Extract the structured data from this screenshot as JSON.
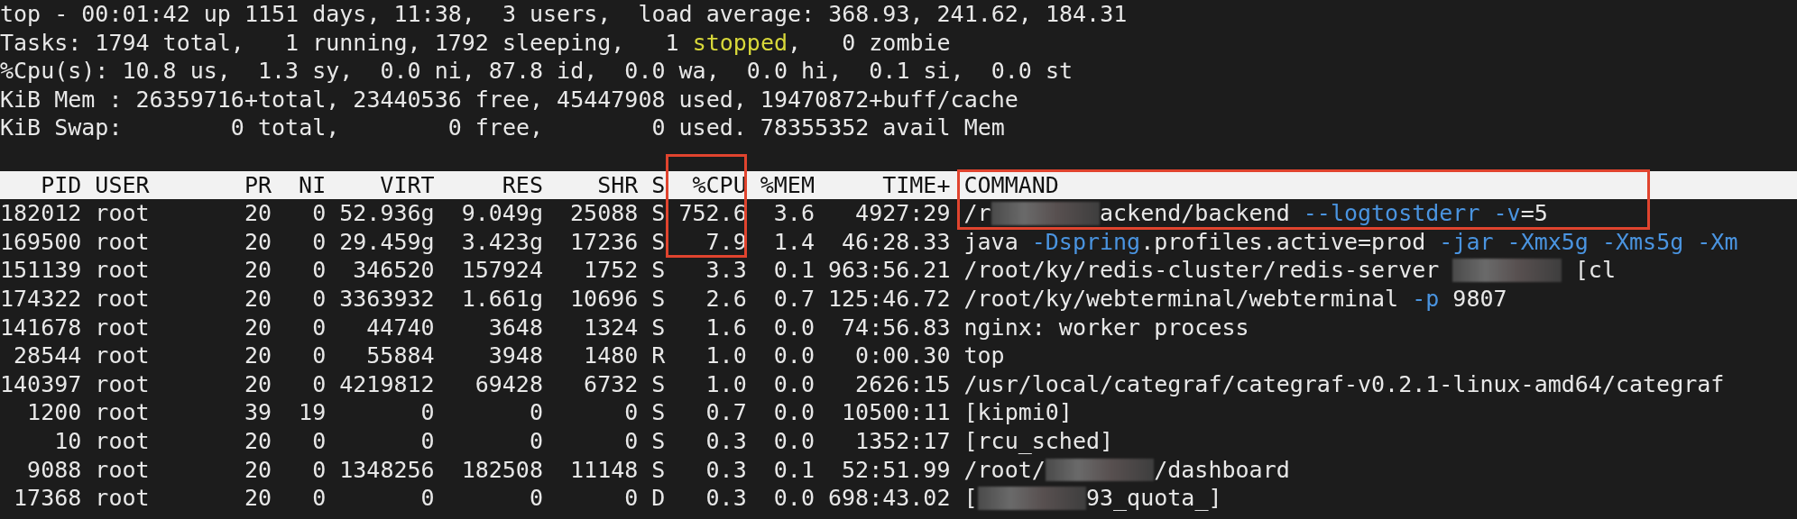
{
  "summary": [
    [
      {
        "kind": "plain",
        "text": "top - 00:01:42 up 1151 days, 11:38,  3 users,  load average: 368.93, 241.62, 184.31"
      }
    ],
    [
      {
        "kind": "plain",
        "text": "Tasks: 1794 total,   1 running, 1792 sleeping,   1 "
      },
      {
        "kind": "stopped",
        "text": "stopped"
      },
      {
        "kind": "plain",
        "text": ",   0 zombie"
      }
    ],
    [
      {
        "kind": "plain",
        "text": "%Cpu(s): 10.8 us,  1.3 sy,  0.0 ni, 87.8 id,  0.0 wa,  0.0 hi,  0.1 si,  0.0 st"
      }
    ],
    [
      {
        "kind": "plain",
        "text": "KiB Mem : 26359716+total, 23440536 free, 45447908 used, 19470872+buff/cache"
      }
    ],
    [
      {
        "kind": "plain",
        "text": "KiB Swap:        0 total,        0 free,        0 used. 78355352 avail Mem"
      }
    ]
  ],
  "columns": [
    "PID",
    "USER",
    "PR",
    "NI",
    "VIRT",
    "RES",
    "SHR",
    "S",
    "%CPU",
    "%MEM",
    "TIME+",
    "COMMAND"
  ],
  "rows": [
    {
      "cpu_boxed": true,
      "command_boxed": true,
      "cells": [
        "182012",
        "root",
        "20",
        "0",
        "52.936g",
        "9.049g",
        "25088",
        "S",
        "752.6",
        "3.6",
        "4927:29"
      ],
      "command": [
        {
          "kind": "plain",
          "text": "/r"
        },
        {
          "kind": "redacted"
        },
        {
          "kind": "plain",
          "text": "ackend/backend "
        },
        {
          "kind": "flag",
          "text": "--logtostderr"
        },
        {
          "kind": "flag",
          "text": " -v"
        },
        {
          "kind": "plain",
          "text": "=5"
        }
      ]
    },
    {
      "cpu_boxed": true,
      "command_boxed": false,
      "cells": [
        "169500",
        "root",
        "20",
        "0",
        "29.459g",
        "3.423g",
        "17236",
        "S",
        "7.9",
        "1.4",
        "46:28.33"
      ],
      "command": [
        {
          "kind": "plain",
          "text": "java "
        },
        {
          "kind": "flag",
          "text": "-Dspring"
        },
        {
          "kind": "plain",
          "text": ".profiles.active=prod "
        },
        {
          "kind": "flag",
          "text": "-jar -Xmx5g -Xms5g -Xm"
        }
      ]
    },
    {
      "cpu_boxed": false,
      "command_boxed": false,
      "cells": [
        "151139",
        "root",
        "20",
        "0",
        "346520",
        "157924",
        "1752",
        "S",
        "3.3",
        "0.1",
        "963:56.21"
      ],
      "command": [
        {
          "kind": "plain",
          "text": "/root/ky/redis-cluster/redis-server "
        },
        {
          "kind": "redacted"
        },
        {
          "kind": "plain",
          "text": " [cl"
        }
      ]
    },
    {
      "cpu_boxed": false,
      "command_boxed": false,
      "cells": [
        "174322",
        "root",
        "20",
        "0",
        "3363932",
        "1.661g",
        "10696",
        "S",
        "2.6",
        "0.7",
        "125:46.72"
      ],
      "command": [
        {
          "kind": "plain",
          "text": "/root/ky/webterminal/webterminal "
        },
        {
          "kind": "flag",
          "text": "-p"
        },
        {
          "kind": "plain",
          "text": " 9807"
        }
      ]
    },
    {
      "cpu_boxed": false,
      "command_boxed": false,
      "cells": [
        "141678",
        "root",
        "20",
        "0",
        "44740",
        "3648",
        "1324",
        "S",
        "1.6",
        "0.0",
        "74:56.83"
      ],
      "command": [
        {
          "kind": "plain",
          "text": "nginx: worker process"
        }
      ]
    },
    {
      "cpu_boxed": false,
      "command_boxed": false,
      "cells": [
        "28544",
        "root",
        "20",
        "0",
        "55884",
        "3948",
        "1480",
        "R",
        "1.0",
        "0.0",
        "0:00.30"
      ],
      "command": [
        {
          "kind": "plain",
          "text": "top"
        }
      ]
    },
    {
      "cpu_boxed": false,
      "command_boxed": false,
      "cells": [
        "140397",
        "root",
        "20",
        "0",
        "4219812",
        "69428",
        "6732",
        "S",
        "1.0",
        "0.0",
        "2626:15"
      ],
      "command": [
        {
          "kind": "plain",
          "text": "/usr/local/categraf/categraf-v0.2.1-linux-amd64/categraf"
        }
      ]
    },
    {
      "cpu_boxed": false,
      "command_boxed": false,
      "cells": [
        "1200",
        "root",
        "39",
        "19",
        "0",
        "0",
        "0",
        "S",
        "0.7",
        "0.0",
        "10500:11"
      ],
      "command": [
        {
          "kind": "plain",
          "text": "[kipmi0]"
        }
      ]
    },
    {
      "cpu_boxed": false,
      "command_boxed": false,
      "cells": [
        "10",
        "root",
        "20",
        "0",
        "0",
        "0",
        "0",
        "S",
        "0.3",
        "0.0",
        "1352:17"
      ],
      "command": [
        {
          "kind": "plain",
          "text": "[rcu_sched]"
        }
      ]
    },
    {
      "cpu_boxed": false,
      "command_boxed": false,
      "cells": [
        "9088",
        "root",
        "20",
        "0",
        "1348256",
        "182508",
        "11148",
        "S",
        "0.3",
        "0.1",
        "52:51.99"
      ],
      "command": [
        {
          "kind": "plain",
          "text": "/root/"
        },
        {
          "kind": "redacted"
        },
        {
          "kind": "plain",
          "text": "/dashboard"
        }
      ]
    },
    {
      "cpu_boxed": false,
      "command_boxed": false,
      "cells": [
        "17368",
        "root",
        "20",
        "0",
        "0",
        "0",
        "0",
        "D",
        "0.3",
        "0.0",
        "698:43.02"
      ],
      "command": [
        {
          "kind": "plain",
          "text": "["
        },
        {
          "kind": "redacted"
        },
        {
          "kind": "plain",
          "text": "93_quota_]"
        }
      ]
    }
  ]
}
